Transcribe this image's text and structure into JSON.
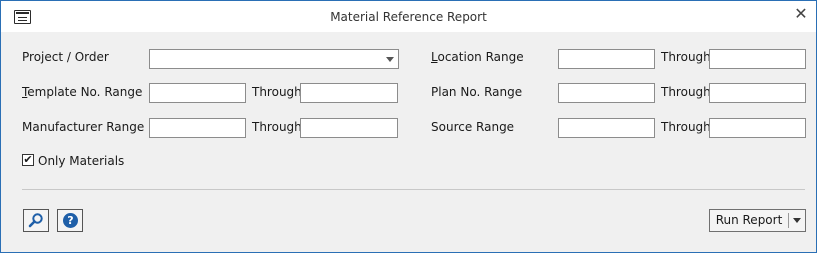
{
  "window": {
    "title": "Material Reference Report",
    "close_glyph": "✕"
  },
  "form": {
    "project_order": {
      "label": "Project / Order",
      "value": ""
    },
    "template_range": {
      "label_first": "T",
      "label_rest": "emplate No. Range",
      "from": "",
      "through_label": "Through",
      "to": ""
    },
    "manufacturer_range": {
      "label": "Manufacturer Range",
      "from": "",
      "through_label": "Through",
      "to": ""
    },
    "location_range": {
      "label_first": "L",
      "label_rest": "ocation Range",
      "from": "",
      "through_label": "Through",
      "to": ""
    },
    "plan_range": {
      "label": "Plan No. Range",
      "from": "",
      "through_label": "Through",
      "to": ""
    },
    "source_range": {
      "label": "Source Range",
      "from": "",
      "through_label": "Through",
      "to": ""
    },
    "only_materials": {
      "label": "Only Materials",
      "checked": true,
      "check_glyph": "✔"
    }
  },
  "footer": {
    "search_icon": "magnifier-icon",
    "help_glyph": "?",
    "run_report_label": "Run Report"
  }
}
